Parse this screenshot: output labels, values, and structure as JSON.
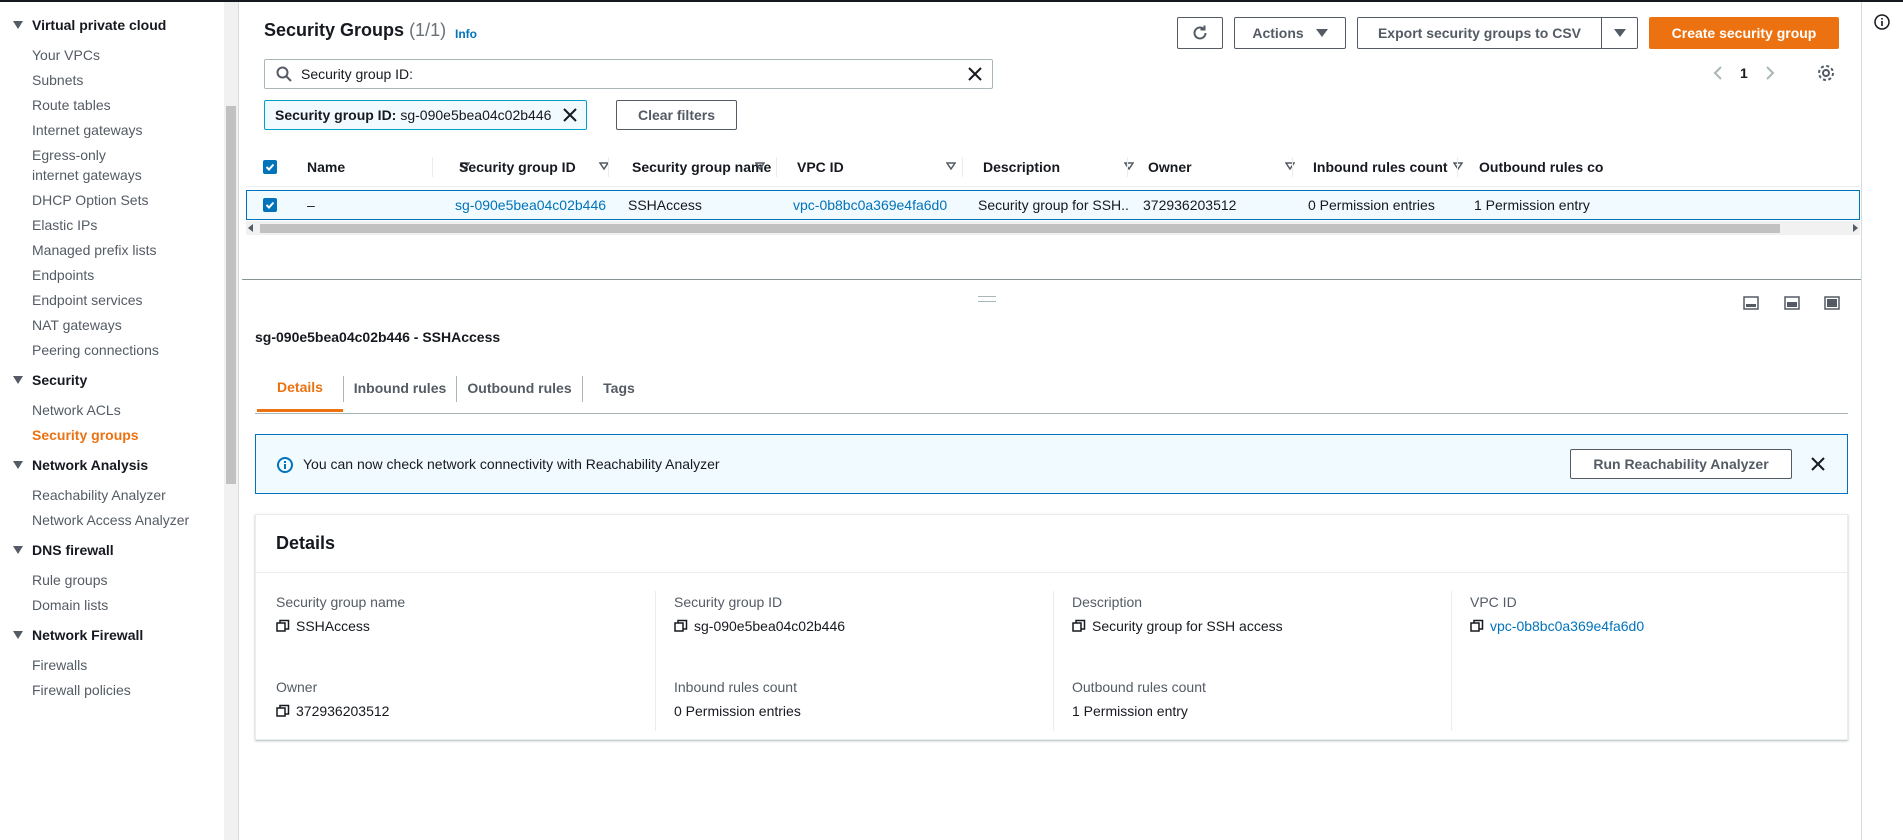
{
  "sidebar": {
    "groups": [
      {
        "title": "Virtual private cloud",
        "items": [
          "Your VPCs",
          "Subnets",
          "Route tables",
          "Internet gateways",
          "Egress-only internet gateways",
          "DHCP Option Sets",
          "Elastic IPs",
          "Managed prefix lists",
          "Endpoints",
          "Endpoint services",
          "NAT gateways",
          "Peering connections"
        ]
      },
      {
        "title": "Security",
        "items": [
          "Network ACLs",
          "Security groups"
        ]
      },
      {
        "title": "Network Analysis",
        "items": [
          "Reachability Analyzer",
          "Network Access Analyzer"
        ]
      },
      {
        "title": "DNS firewall",
        "items": [
          "Rule groups",
          "Domain lists"
        ]
      },
      {
        "title": "Network Firewall",
        "items": [
          "Firewalls",
          "Firewall policies"
        ]
      }
    ],
    "active_item": "Security groups"
  },
  "header": {
    "title": "Security Groups",
    "count": "(1/1)",
    "info": "Info",
    "actions_label": "Actions",
    "export_label": "Export security groups to CSV",
    "create_label": "Create security group"
  },
  "search": {
    "value": "Security group ID:"
  },
  "filter_token": {
    "key": "Security group ID:",
    "value": "sg-090e5bea04c02b446"
  },
  "clear_filters": "Clear filters",
  "pagination": {
    "page": "1"
  },
  "table": {
    "columns": [
      "Name",
      "Security group ID",
      "Security group name",
      "VPC ID",
      "Description",
      "Owner",
      "Inbound rules count",
      "Outbound rules co"
    ],
    "rows": [
      {
        "name": "–",
        "sg_id": "sg-090e5bea04c02b446",
        "sg_name": "SSHAccess",
        "vpc_id": "vpc-0b8bc0a369e4fa6d0",
        "description": "Security group for SSH...",
        "owner": "372936203512",
        "inbound": "0 Permission entries",
        "outbound": "1 Permission entry"
      }
    ]
  },
  "detail": {
    "title": "sg-090e5bea04c02b446 - SSHAccess",
    "tabs": [
      "Details",
      "Inbound rules",
      "Outbound rules",
      "Tags"
    ],
    "active_tab": "Details",
    "flash_message": "You can now check network connectivity with Reachability Analyzer",
    "flash_button": "Run Reachability Analyzer",
    "card_title": "Details",
    "fields": {
      "sg_name_label": "Security group name",
      "sg_name_value": "SSHAccess",
      "sg_id_label": "Security group ID",
      "sg_id_value": "sg-090e5bea04c02b446",
      "description_label": "Description",
      "description_value": "Security group for SSH access",
      "vpc_label": "VPC ID",
      "vpc_value": "vpc-0b8bc0a369e4fa6d0",
      "owner_label": "Owner",
      "owner_value": "372936203512",
      "inbound_label": "Inbound rules count",
      "inbound_value": "0 Permission entries",
      "outbound_label": "Outbound rules count",
      "outbound_value": "1 Permission entry"
    }
  },
  "colors": {
    "accent": "#ec7211",
    "link": "#0073bb",
    "info_bg": "#f1faff"
  }
}
